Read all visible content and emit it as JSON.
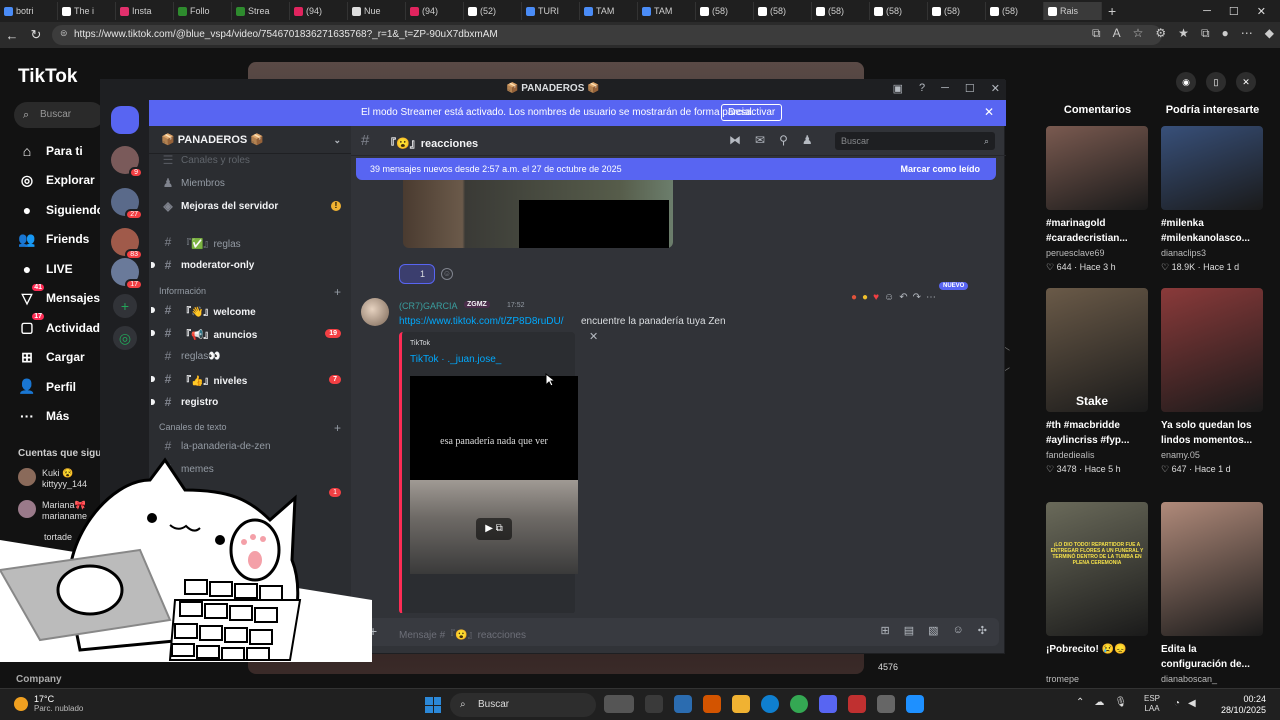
{
  "browser": {
    "tabs": [
      {
        "label": "botri",
        "color": "#4a8cf7"
      },
      {
        "label": "The i",
        "color": "#ffffff"
      },
      {
        "label": "Insta",
        "color": "#e1306c"
      },
      {
        "label": "Follo",
        "color": "#2e8b2e"
      },
      {
        "label": "Strea",
        "color": "#2e8b2e"
      },
      {
        "label": "(94)",
        "color": "#e0245e"
      },
      {
        "label": "Nue",
        "color": "#dddddd"
      },
      {
        "label": "(94)",
        "color": "#e0245e"
      },
      {
        "label": "(52)",
        "color": "#ffffff"
      },
      {
        "label": "TURI",
        "color": "#4a8cf7"
      },
      {
        "label": "TAM",
        "color": "#4a8cf7"
      },
      {
        "label": "TAM",
        "color": "#4a8cf7"
      },
      {
        "label": "(58)",
        "color": "#ffffff"
      },
      {
        "label": "(58)",
        "color": "#ffffff"
      },
      {
        "label": "(58)",
        "color": "#ffffff"
      },
      {
        "label": "(58)",
        "color": "#ffffff"
      },
      {
        "label": "(58)",
        "color": "#ffffff"
      },
      {
        "label": "(58)",
        "color": "#ffffff"
      },
      {
        "label": "Rais",
        "color": "#ffffff"
      }
    ],
    "url": "https://www.tiktok.com/@blue_vsp4/video/7546701836271635768?_r=1&_t=ZP-90uX7dbxmAM"
  },
  "tiktok": {
    "logo": "TikTok",
    "search_placeholder": "Buscar",
    "nav": [
      {
        "label": "Para ti",
        "icon": "home-icon",
        "glyph": "⌂",
        "badge": ""
      },
      {
        "label": "Explorar",
        "icon": "compass-icon",
        "glyph": "◎",
        "badge": ""
      },
      {
        "label": "Siguiendo",
        "icon": "avatar",
        "glyph": "●",
        "badge": ""
      },
      {
        "label": "Friends",
        "icon": "friends-icon",
        "glyph": "👥",
        "badge": ""
      },
      {
        "label": "LIVE",
        "icon": "live-avatar",
        "glyph": "●",
        "badge": ""
      },
      {
        "label": "Mensajes",
        "icon": "messages-icon",
        "glyph": "▽",
        "badge": "41"
      },
      {
        "label": "Actividad",
        "icon": "activity-icon",
        "glyph": "▢",
        "badge": "17"
      },
      {
        "label": "Cargar",
        "icon": "upload-icon",
        "glyph": "⊞",
        "badge": ""
      },
      {
        "label": "Perfil",
        "icon": "profile-icon",
        "glyph": "👤",
        "badge": ""
      },
      {
        "label": "Más",
        "icon": "more-icon",
        "glyph": "···",
        "badge": ""
      }
    ],
    "following_title": "Cuentas que sigue",
    "following": [
      {
        "name": "Kuki 😵",
        "handle": "kittyyy_144"
      },
      {
        "name": "Mariana🎀",
        "handle": "marianame"
      }
    ],
    "following_extra": "tortade",
    "company": "Company",
    "video_count": "4576",
    "right_tabs": [
      "Comentarios",
      "Podría interesarte"
    ],
    "cards": [
      {
        "title": "#marinagold #caradecristian...",
        "user": "peruesclave69",
        "likes": "644",
        "time": "Hace 3 h",
        "color": "#7a5a50"
      },
      {
        "title": "#milenka #milenkanolasco...",
        "user": "dianaclips3",
        "likes": "18.9K",
        "time": "Hace 1 d",
        "color": "#38507a"
      },
      {
        "title": "#th #macbridde #aylincriss #fyp...",
        "user": "fandedieaIis",
        "likes": "3478",
        "time": "Hace 5 h",
        "color": "#6a5a48"
      },
      {
        "title": "Ya solo quedan los lindos momentos...",
        "user": "enamy.05",
        "likes": "647",
        "time": "Hace 1 d",
        "color": "#8a3a3a"
      },
      {
        "title": "¡Pobrecito! 😢😞",
        "user": "tromepe",
        "likes": "",
        "time": "",
        "color": "#6a6a5a"
      },
      {
        "title": "Edita la configuración de...",
        "user": "dianaboscan_",
        "likes": "",
        "time": "",
        "color": "#b08a7a"
      }
    ],
    "card2_overlay": "Stake",
    "card5_overlay": "¡LO DIO TODO! REPARTIDOR FUE A ENTREGAR FLORES A UN FUNERAL Y TERMINÓ DENTRO DE LA TUMBA EN PLENA CEREMONIA"
  },
  "discord": {
    "window_title": "📦 PANADEROS 📦",
    "streamer_text": "El modo Streamer está activado. Los nombres de usuario se mostrarán de forma parcial.",
    "streamer_button": "Desactivar",
    "server_name": "📦 PANADEROS 📦",
    "guilds": [
      {
        "badge": "9",
        "color": "#7a5a5a"
      },
      {
        "badge": "27",
        "color": "#5a6a8a"
      },
      {
        "badge": "83",
        "color": "#a05a4a"
      },
      {
        "badge": "17",
        "color": "#6a7a9a"
      }
    ],
    "channels_top": [
      {
        "label": "Canales y roles",
        "kind": "faded"
      },
      {
        "label": "Miembros",
        "kind": "normal"
      },
      {
        "label": "Mejoras del servidor",
        "kind": "bold"
      }
    ],
    "channel_group1": [
      {
        "label": "『✅』reglas",
        "bold": false,
        "badge": ""
      },
      {
        "label": "moderator-only",
        "bold": true,
        "badge": ""
      }
    ],
    "category_info": "Información",
    "channel_group2": [
      {
        "label": "『👋』welcome",
        "bold": true,
        "badge": ""
      },
      {
        "label": "『📢』anuncios",
        "bold": true,
        "badge": "19"
      },
      {
        "label": "reglas👀",
        "bold": false,
        "badge": ""
      },
      {
        "label": "『👍』niveles",
        "bold": true,
        "badge": "7"
      },
      {
        "label": "registro",
        "bold": true,
        "badge": ""
      }
    ],
    "category_text": "Canales de texto",
    "channel_group3": [
      {
        "label": "la-panaderia-de-zen",
        "bold": false,
        "badge": ""
      },
      {
        "label": "memes",
        "bold": false,
        "badge": ""
      },
      {
        "label": "…s",
        "bold": false,
        "badge": "1"
      }
    ],
    "channel": {
      "name": "『😮』reacciones",
      "search_placeholder": "Buscar"
    },
    "new_messages": {
      "text": "39 mensajes nuevos desde 2:57 a.m. el 27 de octubre de 2025",
      "action": "Marcar como leído"
    },
    "reaction": {
      "count": "1"
    },
    "message": {
      "author": "(CR7)GARCIA",
      "tag": "ZGMZ",
      "time": "17:52",
      "link": "https://www.tiktok.com/t/ZP8D8ruDU/",
      "text": "encuentre la panadería tuya Zen",
      "badge": "NUEVO"
    },
    "embed": {
      "provider": "TikTok",
      "author": "TikTok · ._juan.jose_",
      "caption": "esa panadería nada que ver"
    },
    "composer_placeholder": "Mensaje #『😮』reacciones"
  },
  "taskbar": {
    "weather_temp": "17°C",
    "weather_desc": "Parc. nublado",
    "search": "Buscar",
    "lang1": "ESP",
    "lang2": "LAA",
    "time": "00:24",
    "date": "28/10/2025"
  }
}
